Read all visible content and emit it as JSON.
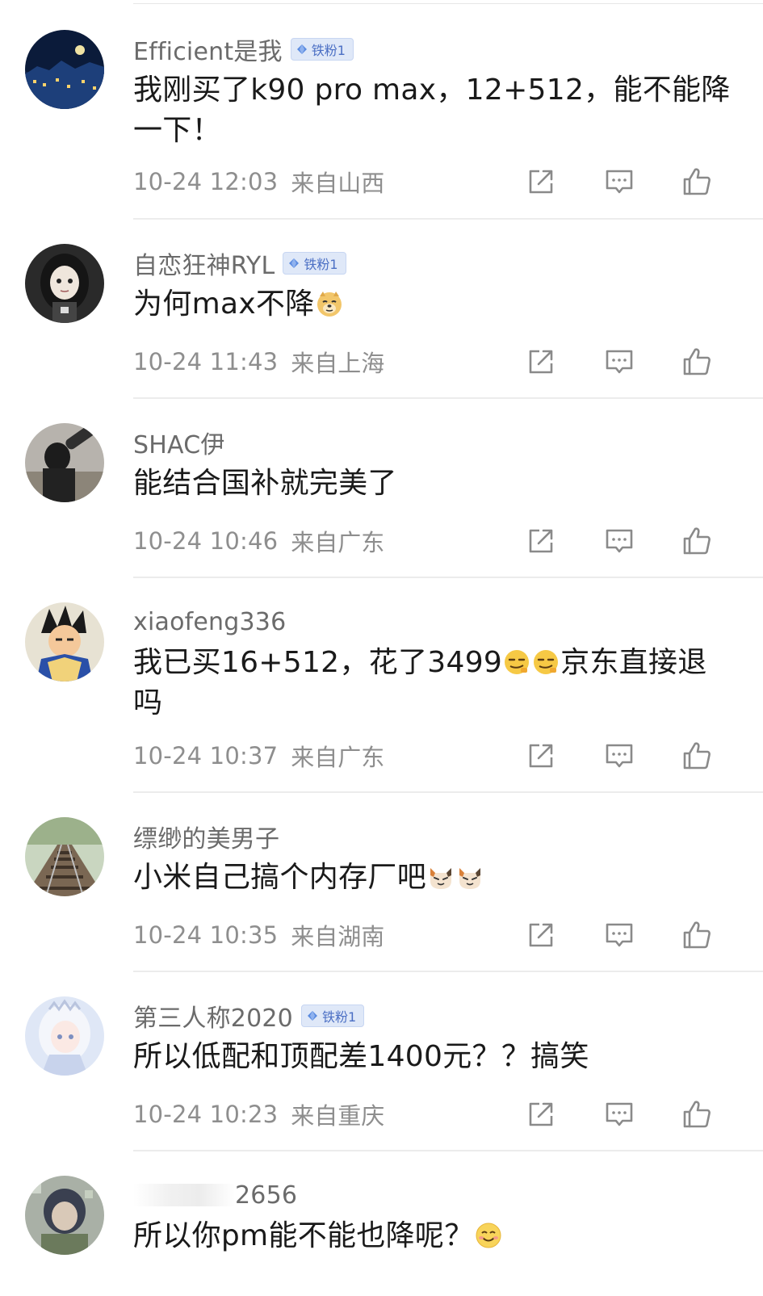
{
  "comments": [
    {
      "username": "Efficient是我",
      "badge": "铁粉1",
      "text": "我刚买了k90 pro max，12+512，能不能降一下！",
      "time": "10-24 12:03",
      "location": "来自山西",
      "avatar_icon": "night-city-avatar"
    },
    {
      "username": "自恋狂神RYL",
      "badge": "铁粉1",
      "text": "为何max不降",
      "emoji": "doge-emoji",
      "time": "10-24 11:43",
      "location": "来自上海",
      "avatar_icon": "anime-girl-avatar"
    },
    {
      "username": "SHAC伊",
      "text": "能结合国补就完美了",
      "time": "10-24 10:46",
      "location": "来自广东",
      "avatar_icon": "photographer-avatar"
    },
    {
      "username": "xiaofeng336",
      "text_before": "我已买16+512，花了3499",
      "text_after": "京东直接退吗",
      "emoji": "sly-smile-emoji",
      "time": "10-24 10:37",
      "location": "来自广东",
      "avatar_icon": "cartoon-warrior-avatar"
    },
    {
      "username": "缥缈的美男子",
      "text": "小米自己搞个内存厂吧",
      "emoji": "cat-face-emoji",
      "time": "10-24 10:35",
      "location": "来自湖南",
      "avatar_icon": "railway-avatar"
    },
    {
      "username": "第三人称2020",
      "badge": "铁粉1",
      "text": "所以低配和顶配差1400元？？搞笑",
      "time": "10-24 10:23",
      "location": "来自重庆",
      "avatar_icon": "white-hair-girl-avatar"
    },
    {
      "username": "2656",
      "text": "所以你pm能不能也降呢？",
      "emoji": "smile-emoji",
      "avatar_icon": "pixel-character-avatar"
    }
  ],
  "colors": {
    "username": "#6b6b6b",
    "meta": "#8e8e8e",
    "badge_bg": "#dfe8f8",
    "badge_text": "#4b6fc4",
    "icon": "#8a8a8a"
  }
}
